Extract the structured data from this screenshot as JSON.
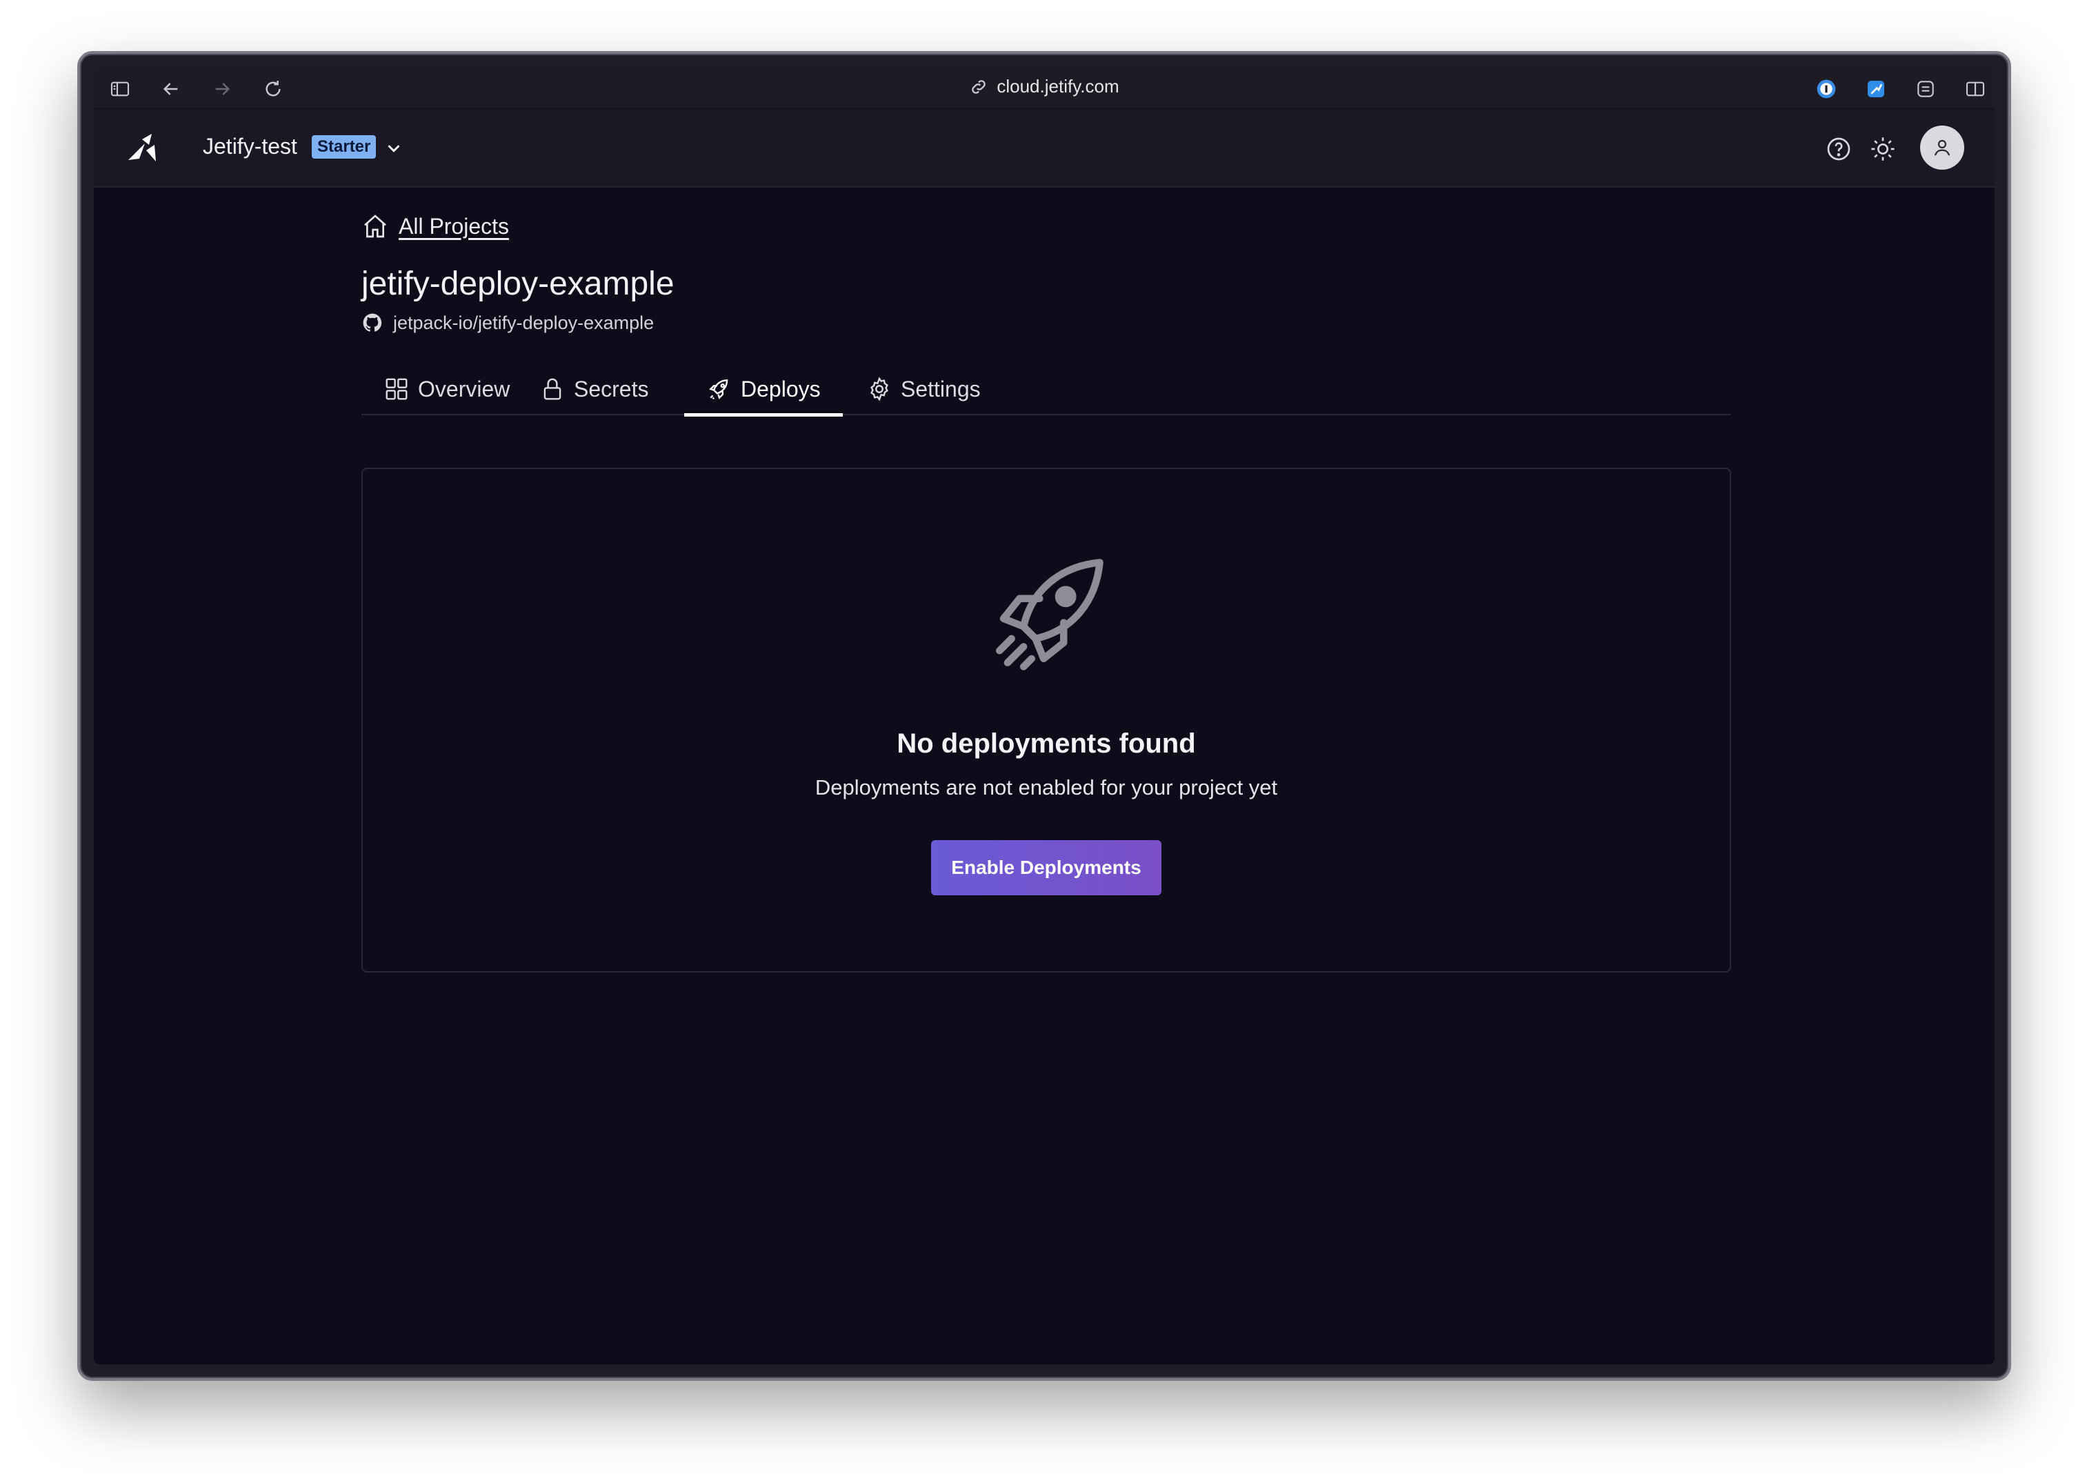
{
  "browser": {
    "url": "cloud.jetify.com",
    "icons": [
      "sidebar-icon",
      "back-icon",
      "forward-icon",
      "reload-icon",
      "link-icon",
      "password-manager-icon",
      "extension-icon",
      "extension2-icon",
      "split-view-icon"
    ]
  },
  "header": {
    "org_name": "Jetify-test",
    "plan_badge": "Starter",
    "icons": [
      "jetify-logo",
      "chevron-down-icon",
      "help-icon",
      "theme-toggle-icon",
      "user-avatar-icon"
    ]
  },
  "breadcrumb": {
    "label": "All Projects",
    "icon": "home-icon"
  },
  "project": {
    "title": "jetify-deploy-example",
    "repo": "jetpack-io/jetify-deploy-example",
    "repo_icon": "github-icon"
  },
  "tabs": [
    {
      "label": "Overview",
      "icon": "grid-icon",
      "active": false
    },
    {
      "label": "Secrets",
      "icon": "lock-icon",
      "active": false
    },
    {
      "label": "Deploys",
      "icon": "rocket-icon",
      "active": true
    },
    {
      "label": "Settings",
      "icon": "gear-icon",
      "active": false
    }
  ],
  "empty_state": {
    "icon": "rocket-icon",
    "title": "No deployments found",
    "subtitle": "Deployments are not enabled for your project yet",
    "button_label": "Enable Deployments"
  },
  "colors": {
    "background": "#0e0b1b",
    "header": "#1a1824",
    "badge": "#7fb0f2",
    "button_start": "#6a5bd6",
    "button_end": "#7a4fc7"
  }
}
